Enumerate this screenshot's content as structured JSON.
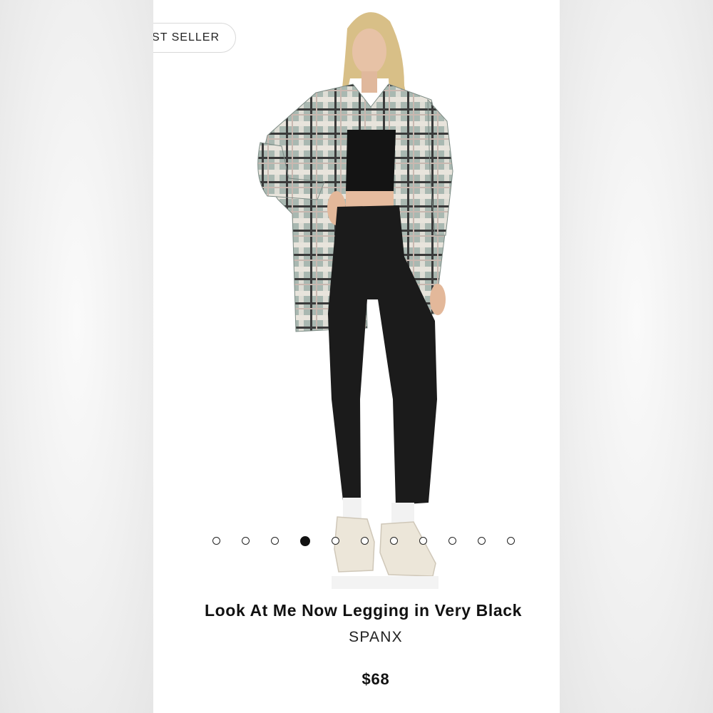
{
  "badge": {
    "label": "EST SELLER"
  },
  "product": {
    "title": "Look At Me Now Legging in Very Black",
    "brand": "SPANX",
    "price": "$68",
    "image_alt": "Model wearing black leggings, black crop top, grey plaid flannel shirt and cream sneakers"
  },
  "carousel": {
    "total_slides": 11,
    "active_index": 3
  },
  "colors": {
    "background": "#ffffff",
    "text": "#111111",
    "plaid": "#9fafa8",
    "legging": "#1a1a1a"
  }
}
